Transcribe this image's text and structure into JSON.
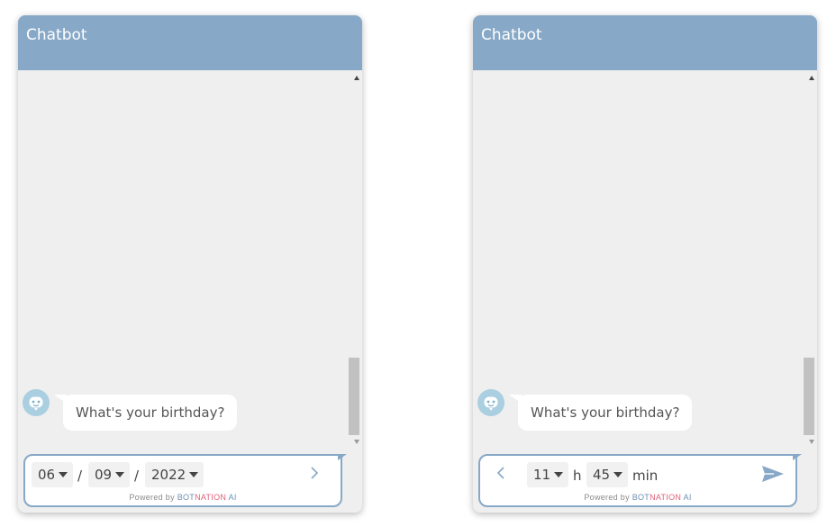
{
  "widgets": [
    {
      "title": "Chatbot",
      "message": "What's your birthday?",
      "date": {
        "day": "06",
        "month": "09",
        "year": "2022",
        "separator": "/"
      },
      "next_icon": "chevron-right-icon"
    },
    {
      "title": "Chatbot",
      "message": "What's your birthday?",
      "time": {
        "hour": "11",
        "hour_unit": "h",
        "minute": "45",
        "minute_unit": "min"
      },
      "back_icon": "chevron-left-icon",
      "send_icon": "send-icon"
    }
  ],
  "powered": {
    "prefix": "Powered by",
    "brand1": "BOT",
    "brand2": "NATION",
    "brand3": "AI"
  },
  "colors": {
    "header": "#87a8c7",
    "panel": "#efefef",
    "accent_red": "#e0607a"
  }
}
